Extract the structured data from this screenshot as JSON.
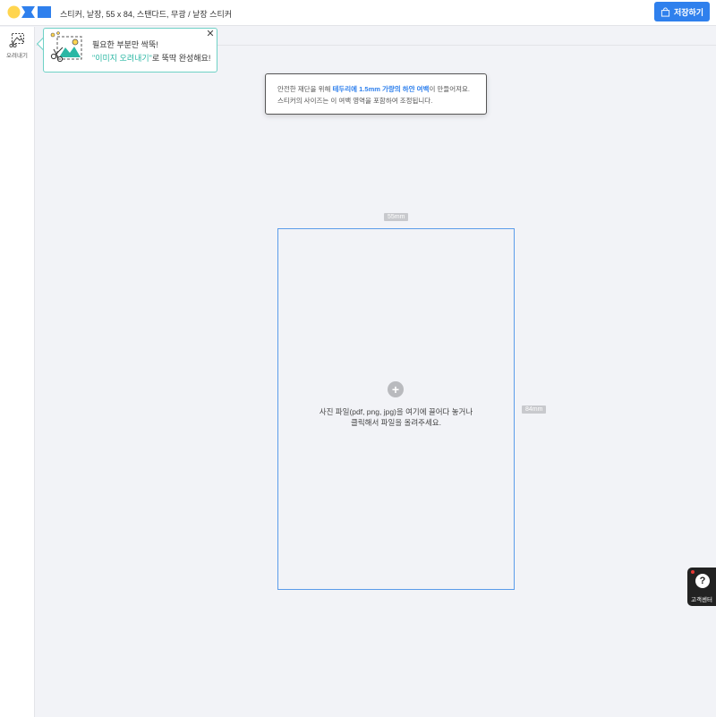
{
  "header": {
    "document_title": "스티커, 낱장, 55 x 84, 스탠다드, 무광 / 낱장 스티커",
    "save_label": "저장하기",
    "logo_icon": "brand-logo-icon",
    "save_icon": "shopping-bag-icon"
  },
  "sidebar": {
    "tools": [
      {
        "label": "오려내기",
        "icon": "crop-image-icon"
      }
    ]
  },
  "tooltip": {
    "line1": "필요한 부분만 싹뚝!",
    "line2_highlight": "\"이미지 오려내기\"",
    "line2_rest": "로 뚝딱 완성해요!",
    "close_icon": "close-icon"
  },
  "info_notice": {
    "line1_pre": "안전한 재단을 위해 ",
    "line1_highlight": "테두리에 1.5mm 가량의 하얀 여백",
    "line1_post": "이 만들어져요.",
    "line2": "스티커의 사이즈는 이 여백 영역을 포함하여 조정됩니다."
  },
  "canvas": {
    "width_label": "55mm",
    "height_label": "84mm",
    "drop_line1": "사진 파일(pdf, png, jpg)을 여기에 끌어다 놓거나",
    "drop_line2": "클릭해서 파일을 올려주세요.",
    "add_icon": "plus-icon"
  },
  "help": {
    "label": "고객센터",
    "icon": "question-icon"
  },
  "colors": {
    "accent_blue": "#2f80ed",
    "teal": "#2bb7a4",
    "logo_yellow": "#ffd54f",
    "background": "#f2f3f7"
  }
}
